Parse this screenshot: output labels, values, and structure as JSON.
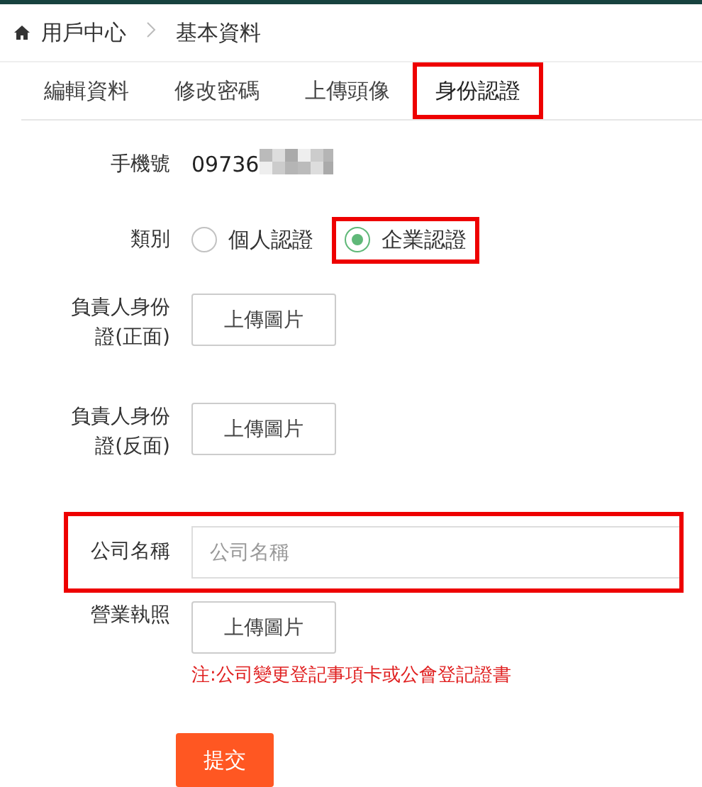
{
  "breadcrumb": [
    "用戶中心",
    "基本資料"
  ],
  "tabs": [
    {
      "label": "編輯資料",
      "selected": false,
      "highlighted": false
    },
    {
      "label": "修改密碼",
      "selected": false,
      "highlighted": false
    },
    {
      "label": "上傳頭像",
      "selected": false,
      "highlighted": false
    },
    {
      "label": "身份認證",
      "selected": true,
      "highlighted": true
    }
  ],
  "form": [
    {
      "kind": "text",
      "label": "手機號",
      "value": "09736",
      "redacted": true
    },
    {
      "kind": "radio",
      "label": "類別",
      "options": [
        {
          "label": "個人認證",
          "selected": false,
          "highlighted": false
        },
        {
          "label": "企業認證",
          "selected": true,
          "highlighted": true
        }
      ]
    },
    {
      "kind": "upload",
      "label": "負責人身份證(正面)",
      "button": "上傳圖片"
    },
    {
      "kind": "upload",
      "label": "負責人身份證(反面)",
      "button": "上傳圖片"
    },
    {
      "kind": "input",
      "label": "公司名稱",
      "placeholder": "公司名稱",
      "highlighted": true
    },
    {
      "kind": "upload",
      "label": "營業執照",
      "button": "上傳圖片",
      "note": "注:公司變更登記事項卡或公會登記證書"
    }
  ],
  "submit": "提交"
}
